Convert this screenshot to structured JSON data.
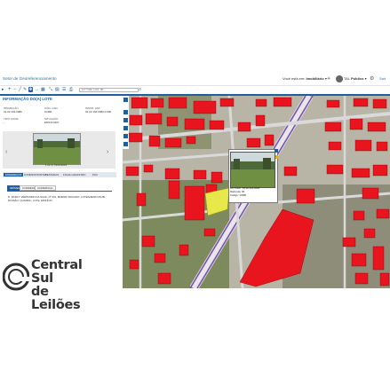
{
  "header": {
    "title": "Setor de Georeferenciamento",
    "question": "Você está em:",
    "location": "Imobiliário",
    "user_label": "Público",
    "exit_label": "Sair",
    "role_label": "TAL"
  },
  "search": {
    "placeholder": "Ex: Rua, Cód. de..."
  },
  "panel": {
    "title": "INFORMAÇÃO DO(A) LOTE",
    "fields": [
      {
        "label": "INSCRIÇÃO",
        "value": "01.02.104.0080"
      },
      {
        "label": "CÓD. CAD.",
        "value": "10480"
      },
      {
        "label": "INSCR. ANT.",
        "value": "01.02.104.0080.0.000"
      },
      {
        "label": "TIPO CONS.",
        "value": "-"
      },
      {
        "label": "SITUAÇÃO",
        "value": "EDIFICADO"
      }
    ]
  },
  "carousel": {
    "caption": "1 de 1 | 01/10/2019"
  },
  "tabs": [
    {
      "label": "ENDEREÇOS",
      "active": true
    },
    {
      "label": "CONFRONTANTES"
    },
    {
      "label": "TESTADAS"
    },
    {
      "label": "FICHA CADASTRO"
    },
    {
      "label": "PGV"
    }
  ],
  "subtabs": [
    {
      "label": "IMÓVEL",
      "active": true
    },
    {
      "label": "CORRESP."
    },
    {
      "label": "COMERCIAL"
    }
  ],
  "address": "R. DARCY VERISSIMO DA SILVA, Nº 291, BAIRRO ROCADO. LOTEAMENTO/SUB-DIVISÃO: QUADRA ; LOTE. EDIFÍCIO:",
  "popup": {
    "line1": "Ins. Imob.: 01.02.104.0080",
    "line2": "Matrícula: 00",
    "line3": "Código: 10480"
  },
  "logo": {
    "line1": "Central Sul",
    "line2": "de Leilões"
  },
  "colors": {
    "accent": "#1e5fa0",
    "building": "#e8141e",
    "highlight_lot": "#e8e84a",
    "road": "#cfcfcf",
    "divider": "#7d4fb3"
  },
  "icons": [
    "search-icon",
    "zoom-in-icon",
    "zoom-out-icon",
    "pan-icon",
    "measure-icon",
    "print-icon",
    "home-icon",
    "gear-icon",
    "user-icon",
    "bell-icon"
  ]
}
